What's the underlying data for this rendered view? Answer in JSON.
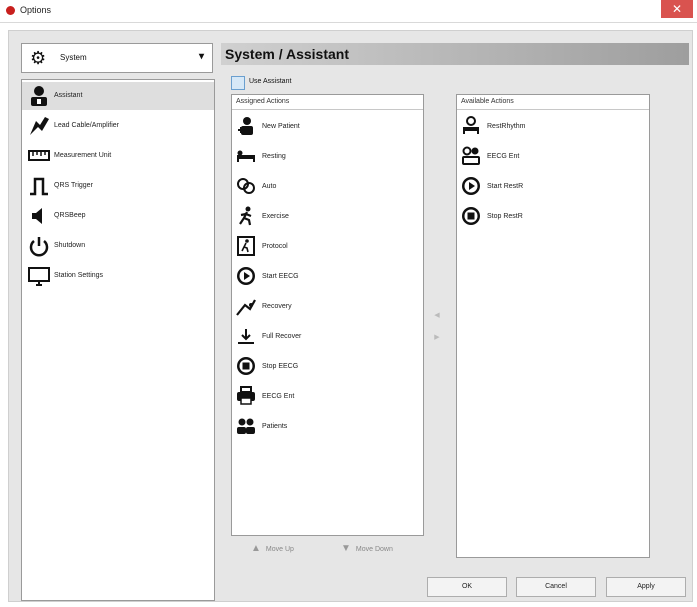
{
  "window": {
    "title": "Options",
    "close_label": "✕"
  },
  "category_select": {
    "value": "System",
    "icon": "gear-icon"
  },
  "left_menu": [
    {
      "label": "Assistant",
      "icon": "person-icon",
      "selected": true
    },
    {
      "label": "Lead Cable/Amplifier",
      "icon": "cable-icon",
      "selected": false
    },
    {
      "label": "Measurement Unit",
      "icon": "ruler-icon",
      "selected": false
    },
    {
      "label": "QRS Trigger",
      "icon": "pulse-icon",
      "selected": false
    },
    {
      "label": "QRSBeep",
      "icon": "speaker-icon",
      "selected": false
    },
    {
      "label": "Shutdown",
      "icon": "power-icon",
      "selected": false
    },
    {
      "label": "Station Settings",
      "icon": "monitor-icon",
      "selected": false
    }
  ],
  "section_title": "System / Assistant",
  "use_assistant": {
    "label": "Use Assistant",
    "checked": false
  },
  "assigned": {
    "header": "Assigned Actions",
    "items": [
      {
        "label": "New Patient",
        "icon": "new-patient-icon"
      },
      {
        "label": "Resting",
        "icon": "resting-icon"
      },
      {
        "label": "Auto",
        "icon": "auto-icon"
      },
      {
        "label": "Exercise",
        "icon": "exercise-icon"
      },
      {
        "label": "Protocol",
        "icon": "protocol-icon"
      },
      {
        "label": "Start EECG",
        "icon": "play-circle-icon"
      },
      {
        "label": "Recovery",
        "icon": "recovery-icon"
      },
      {
        "label": "Full Recover",
        "icon": "full-recover-icon"
      },
      {
        "label": "Stop EECG",
        "icon": "stop-circle-icon"
      },
      {
        "label": "EECG Ent",
        "icon": "printer-icon"
      },
      {
        "label": "Patients",
        "icon": "patients-icon"
      }
    ]
  },
  "available": {
    "header": "Available Actions",
    "items": [
      {
        "label": "RestRhythm",
        "icon": "rest-rhythm-icon"
      },
      {
        "label": "EECG Ent",
        "icon": "eecg-ent-icon"
      },
      {
        "label": "Start RestR",
        "icon": "play-circle-icon"
      },
      {
        "label": "Stop RestR",
        "icon": "stop-circle-icon"
      }
    ]
  },
  "move_up_label": "Move Up",
  "move_down_label": "Move Down",
  "buttons": {
    "ok": "OK",
    "cancel": "Cancel",
    "apply": "Apply"
  }
}
